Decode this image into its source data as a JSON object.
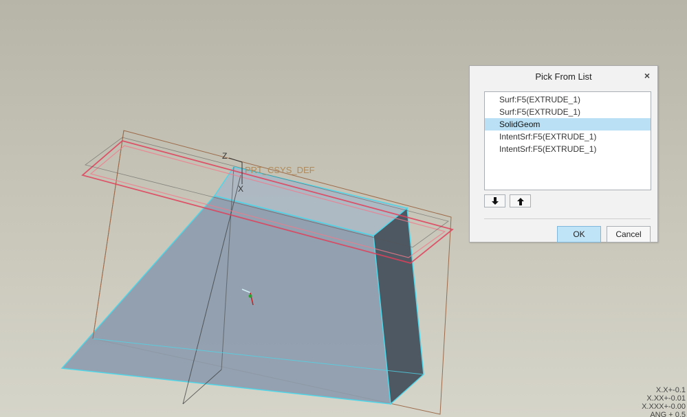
{
  "viewport": {
    "csys_label": "PRT_CSYS_DEF",
    "axis_z": "Z",
    "axis_x": "X"
  },
  "dialog": {
    "title": "Pick From List",
    "close_glyph": "×",
    "items": [
      {
        "label": "Surf:F5(EXTRUDE_1)",
        "selected": false
      },
      {
        "label": "Surf:F5(EXTRUDE_1)",
        "selected": false
      },
      {
        "label": "SolidGeom",
        "selected": true
      },
      {
        "label": "IntentSrf:F5(EXTRUDE_1)",
        "selected": false
      },
      {
        "label": "IntentSrf:F5(EXTRUDE_1)",
        "selected": false
      }
    ],
    "move_down_icon": "arrow-down-icon",
    "move_up_icon": "arrow-up-icon",
    "move_down_glyph": "🡇",
    "move_up_glyph": "🡅",
    "ok_label": "OK",
    "cancel_label": "Cancel"
  },
  "tolerances": {
    "line1": "X.X+-0.1",
    "line2": "X.XX+-0.01",
    "line3": "X.XXX+-0.00",
    "line4": "ANG + 0.5"
  },
  "colors": {
    "selection_highlight": "#b9e0f5",
    "preselect_outline": "#e0405a",
    "edge_highlight": "#4fd6e8",
    "solid_face": "#8d9cae",
    "side_face": "#4e5862",
    "datum_plane": "#9c6a4a"
  }
}
